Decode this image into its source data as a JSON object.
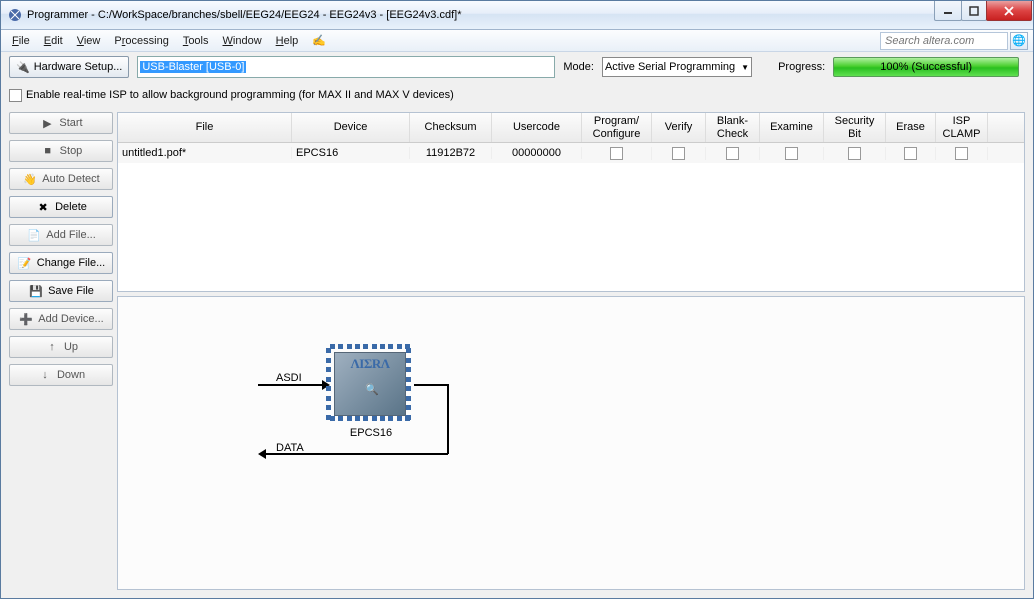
{
  "titlebar": {
    "text": "Programmer - C:/WorkSpace/branches/sbell/EEG24/EEG24 - EEG24v3 - [EEG24v3.cdf]*"
  },
  "menubar": {
    "file": "File",
    "edit": "Edit",
    "view": "View",
    "processing": "Processing",
    "tools": "Tools",
    "window": "Window",
    "help": "Help"
  },
  "search": {
    "placeholder": "Search altera.com"
  },
  "toolbar": {
    "hardware_setup": "Hardware Setup...",
    "hardware_value": "USB-Blaster [USB-0]",
    "mode_label": "Mode:",
    "mode_value": "Active Serial Programming",
    "progress_label": "Progress:",
    "progress_text": "100% (Successful)"
  },
  "isp": {
    "label": "Enable real-time ISP to allow background programming (for MAX II and MAX V devices)"
  },
  "side_buttons": {
    "start": "Start",
    "stop": "Stop",
    "auto_detect": "Auto Detect",
    "delete": "Delete",
    "add_file": "Add File...",
    "change_file": "Change File...",
    "save_file": "Save File",
    "add_device": "Add Device...",
    "up": "Up",
    "down": "Down"
  },
  "table": {
    "headers": {
      "file": "File",
      "device": "Device",
      "checksum": "Checksum",
      "usercode": "Usercode",
      "program": "Program/\nConfigure",
      "verify": "Verify",
      "blank": "Blank-\nCheck",
      "examine": "Examine",
      "security": "Security\nBit",
      "erase": "Erase",
      "isp": "ISP\nCLAMP"
    },
    "rows": [
      {
        "file": "untitled1.pof*",
        "device": "EPCS16",
        "checksum": "11912B72",
        "usercode": "00000000"
      }
    ]
  },
  "diagram": {
    "asdi": "ASDI",
    "data": "DATA",
    "chip_label": "EPCS16",
    "chip_logo": "ΛIΣRΛ"
  }
}
